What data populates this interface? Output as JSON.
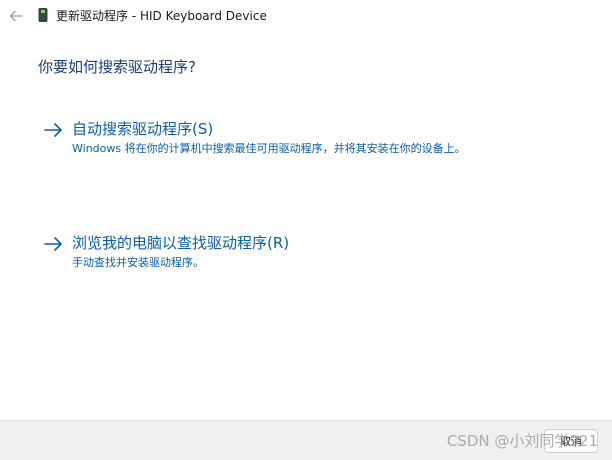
{
  "window": {
    "title": "更新驱动程序 - HID Keyboard Device"
  },
  "icons": {
    "back": "back-arrow-icon",
    "device": "device-icon",
    "option_arrow": "right-arrow-icon"
  },
  "main": {
    "heading": "你要如何搜索驱动程序?",
    "options": [
      {
        "title": "自动搜索驱动程序(S)",
        "description": "Windows 将在你的计算机中搜索最佳可用驱动程序，并将其安装在你的设备上。"
      },
      {
        "title": "浏览我的电脑以查找驱动程序(R)",
        "description": "手动查找并安装驱动程序。"
      }
    ]
  },
  "footer": {
    "cancel_label": "取消",
    "watermark": "CSDN @小刘同学921"
  },
  "colors": {
    "link": "#0a5fa8",
    "heading": "#1f3f73",
    "footer_bg": "#f0f0f0"
  }
}
